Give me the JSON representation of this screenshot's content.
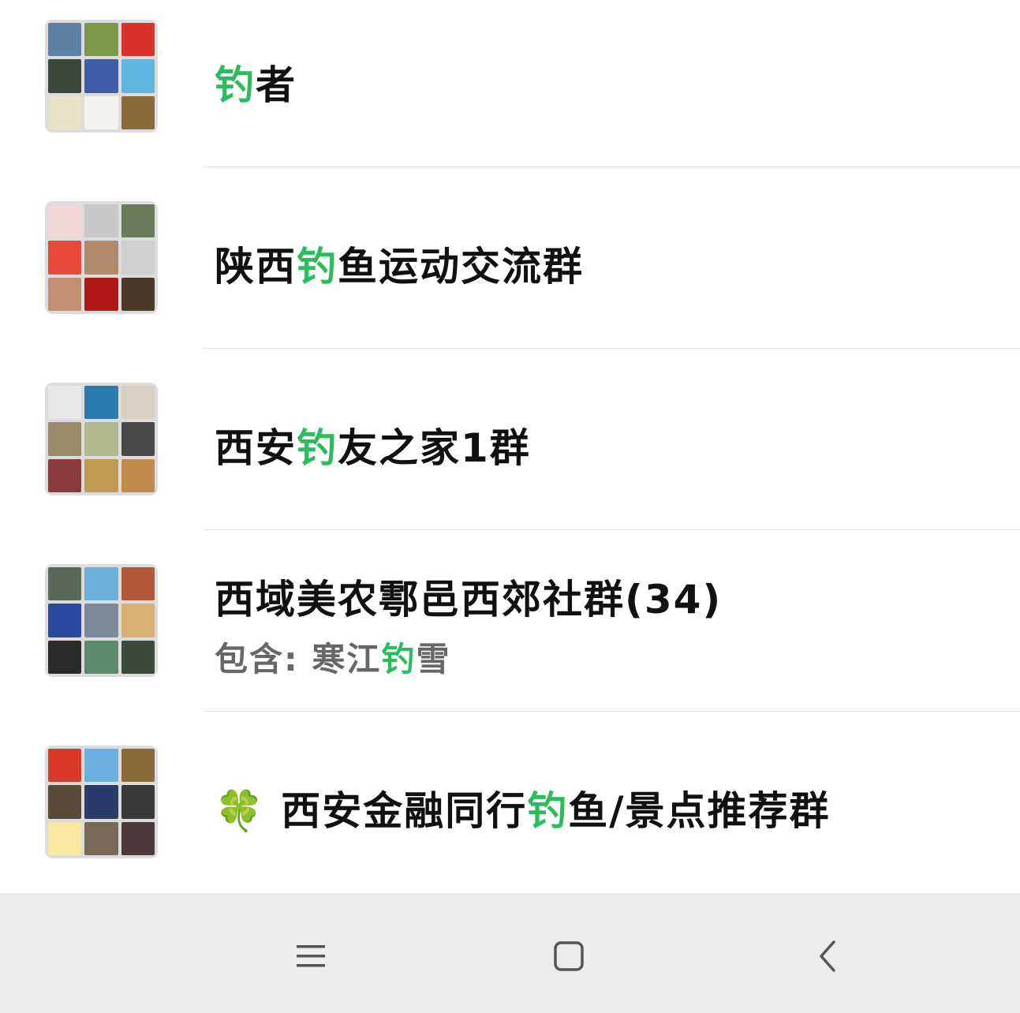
{
  "results": [
    {
      "name_parts": [
        {
          "text": "钓",
          "hl": true
        },
        {
          "text": "者",
          "hl": false
        }
      ],
      "sub": null,
      "avatar_colors": [
        "#5c7fa3",
        "#7a9a4a",
        "#d8322a",
        "#3a4a3a",
        "#3e5fa8",
        "#5fb6e0",
        "#e8e2c8",
        "#f2f2ee",
        "#8a6a3a"
      ]
    },
    {
      "name_parts": [
        {
          "text": "陕西",
          "hl": false
        },
        {
          "text": "钓",
          "hl": true
        },
        {
          "text": "鱼运动交流群",
          "hl": false
        }
      ],
      "sub": null,
      "avatar_colors": [
        "#f0d6d6",
        "#c8c8c8",
        "#6a7a5a",
        "#e84a3a",
        "#b08a6a",
        "#d0d0d0",
        "#c09070",
        "#b01818",
        "#4a3a2a"
      ]
    },
    {
      "name_parts": [
        {
          "text": "西安",
          "hl": false
        },
        {
          "text": "钓",
          "hl": true
        },
        {
          "text": "友之家1群",
          "hl": false
        }
      ],
      "sub": null,
      "avatar_colors": [
        "#e8e8e8",
        "#2a7ab0",
        "#d8d0c0",
        "#9a8a6a",
        "#b0b890",
        "#4a4a4a",
        "#8a3a3a",
        "#c09a50",
        "#c08a4a"
      ]
    },
    {
      "name_parts": [
        {
          "text": "西域美农鄠邑西郊社群(34)",
          "hl": false
        }
      ],
      "sub": {
        "prefix": "包含: 寒江",
        "hl": "钓",
        "suffix": "雪"
      },
      "avatar_colors": [
        "#5a6a5a",
        "#6ab0d8",
        "#b05a3a",
        "#2a4aa0",
        "#7a8a9a",
        "#d8b070",
        "#2a2a2a",
        "#5a8a6a",
        "#3a4a3a"
      ]
    },
    {
      "name_parts": [
        {
          "text": "西安金融同行",
          "hl": false
        },
        {
          "text": "钓",
          "hl": true
        },
        {
          "text": "鱼/景点推荐群",
          "hl": false
        }
      ],
      "clover": "🍀",
      "sub": null,
      "avatar_colors": [
        "#d83a2a",
        "#6ab0e0",
        "#8a6a3a",
        "#5a4a3a",
        "#2a3a6a",
        "#3a3a3a",
        "#f8e8a0",
        "#7a6a5a",
        "#4a3a3a"
      ]
    }
  ],
  "navbar": {
    "menu_icon": "menu-icon",
    "home_icon": "home-square-icon",
    "back_icon": "back-chevron-icon"
  },
  "colors": {
    "highlight": "#2dbb5d",
    "text": "#111111",
    "subtext": "#666666",
    "navbar_bg": "#ececec"
  }
}
